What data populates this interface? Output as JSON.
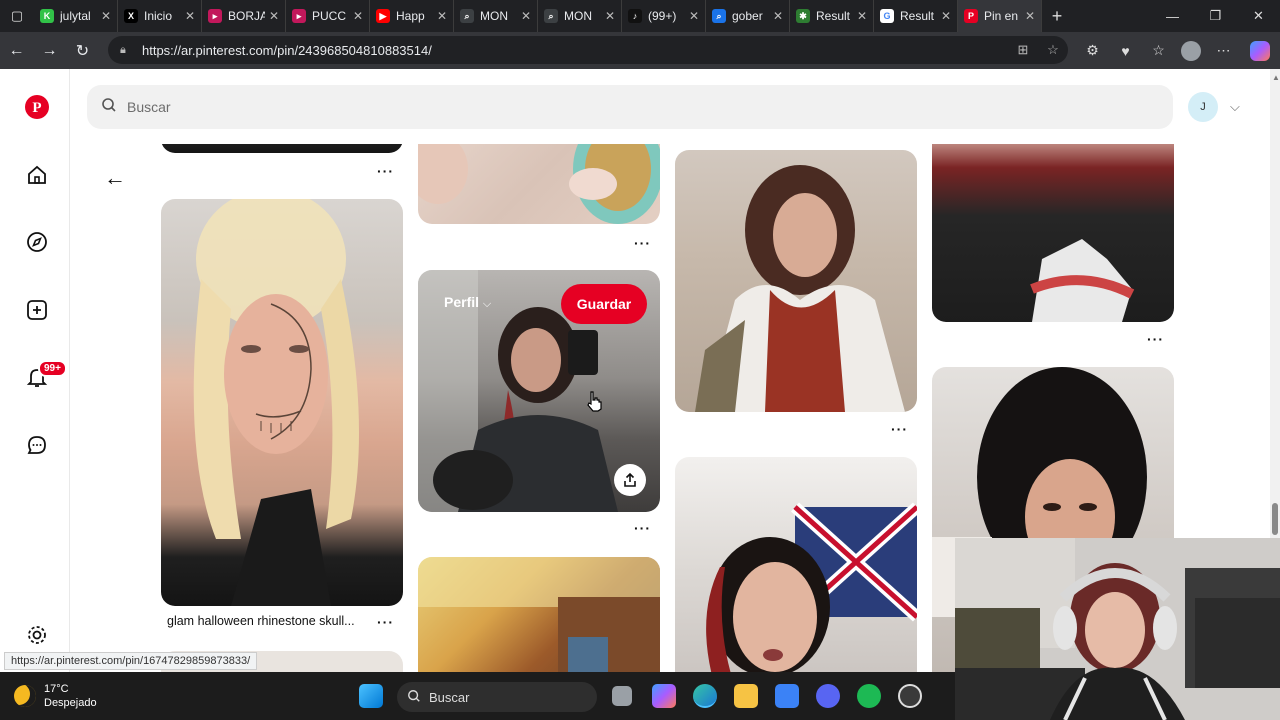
{
  "browser": {
    "tabs": [
      {
        "label": "julytal",
        "fav_color": "#31c248",
        "fav_glyph": "K"
      },
      {
        "label": "Inicio",
        "fav_color": "#000000",
        "fav_glyph": "X"
      },
      {
        "label": "BORJA",
        "fav_color": "#c2185b",
        "fav_glyph": "▸"
      },
      {
        "label": "PUCC",
        "fav_color": "#c2185b",
        "fav_glyph": "▸"
      },
      {
        "label": "Happ",
        "fav_color": "#ff0000",
        "fav_glyph": "▶"
      },
      {
        "label": "MON",
        "fav_color": "#3c4043",
        "fav_glyph": "⌕"
      },
      {
        "label": "MON",
        "fav_color": "#3c4043",
        "fav_glyph": "⌕"
      },
      {
        "label": "(99+)",
        "fav_color": "#111111",
        "fav_glyph": "♪"
      },
      {
        "label": "gober",
        "fav_color": "#1a73e8",
        "fav_glyph": "⌕"
      },
      {
        "label": "Result",
        "fav_color": "#2e7d32",
        "fav_glyph": "✱"
      },
      {
        "label": "Result",
        "fav_color": "#ffffff",
        "fav_glyph": "G"
      },
      {
        "label": "Pin en",
        "fav_color": "#e60023",
        "fav_glyph": "P"
      }
    ],
    "url": "https://ar.pinterest.com/pin/243968504810883514/",
    "status_url": "https://ar.pinterest.com/pin/16747829859873833/"
  },
  "pinterest": {
    "search_placeholder": "Buscar",
    "avatar_initial": "J",
    "notifications_badge": "99+",
    "pin_titles": {
      "col1_pin2": "glam halloween rhinestone skull..."
    },
    "hover_overlay": {
      "profile_label": "Perfil",
      "save_label": "Guardar"
    },
    "brand_color": "#e60023"
  },
  "taskbar": {
    "temperature": "17°C",
    "weather": "Despejado",
    "search_label": "Buscar"
  }
}
